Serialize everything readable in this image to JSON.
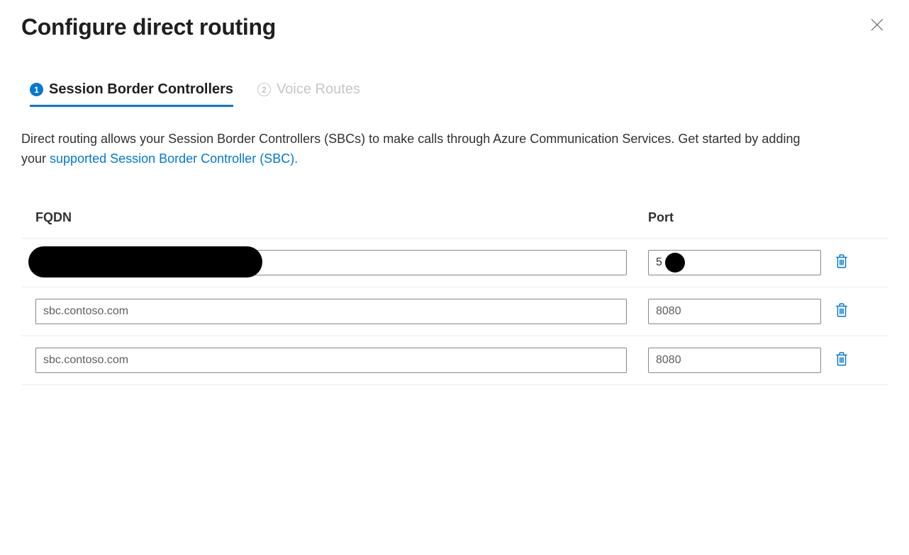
{
  "header": {
    "title": "Configure direct routing"
  },
  "tabs": [
    {
      "step": "1",
      "label": "Session Border Controllers",
      "active": true
    },
    {
      "step": "2",
      "label": "Voice Routes",
      "active": false
    }
  ],
  "description": {
    "text_before": "Direct routing allows your Session Border Controllers (SBCs) to make calls through Azure Communication Services. Get started by adding your ",
    "link_text": "supported Session Border Controller (SBC).",
    "text_after": ""
  },
  "table": {
    "headers": {
      "fqdn": "FQDN",
      "port": "Port"
    },
    "placeholders": {
      "fqdn": "sbc.contoso.com",
      "port": "8080"
    },
    "rows": [
      {
        "fqdn": "",
        "port": "5",
        "redacted": true
      },
      {
        "fqdn": "",
        "port": "",
        "redacted": false
      },
      {
        "fqdn": "",
        "port": "",
        "redacted": false
      }
    ]
  }
}
